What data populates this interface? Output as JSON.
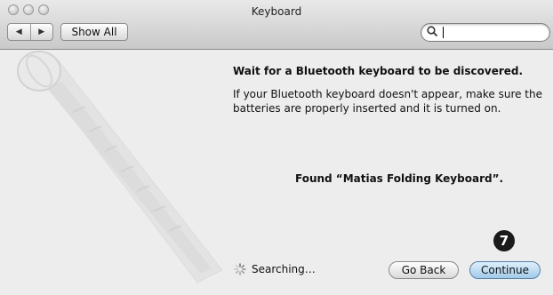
{
  "window": {
    "title": "Keyboard"
  },
  "toolbar": {
    "back_arrow": "◀",
    "forward_arrow": "▶",
    "show_all_label": "Show All"
  },
  "search": {
    "icon": "search-icon",
    "value": ""
  },
  "main": {
    "heading": "Wait for a Bluetooth keyboard to be discovered.",
    "instructions": "If your Bluetooth keyboard doesn't appear, make sure the batteries are properly inserted and it is turned on.",
    "found_text": "Found “Matias Folding Keyboard”.",
    "status_text": "Searching…",
    "step_badge": "7"
  },
  "buttons": {
    "go_back_label": "Go Back",
    "continue_label": "Continue"
  },
  "colors": {
    "accent_button": "#9fcbe9",
    "badge": "#1a1a1a"
  }
}
